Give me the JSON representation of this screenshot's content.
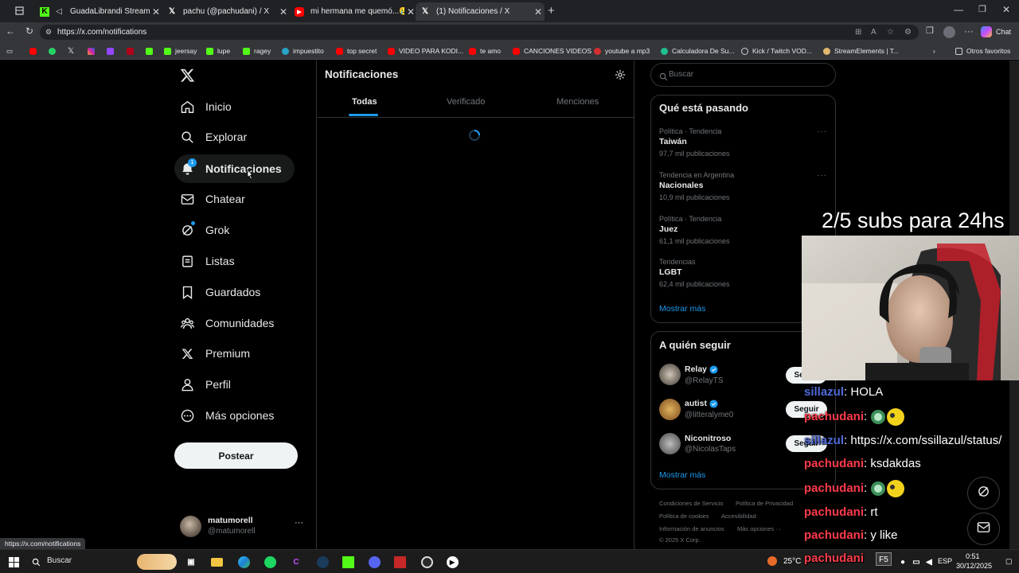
{
  "browser": {
    "tabs": [
      {
        "title": "GuadaLibrandi Stream - Watc",
        "icon": "kick-icon",
        "color": "#53fc18"
      },
      {
        "title": "pachu (@pachudani) / X",
        "icon": "x-icon",
        "color": "#ffffff"
      },
      {
        "title": "mi hermana me quemó...😢 - You",
        "icon": "youtube-icon",
        "color": "#ff0000"
      },
      {
        "title": "(1) Notificaciones / X",
        "icon": "x-icon",
        "color": "#ffffff"
      }
    ],
    "url": "https://x.com/notifications",
    "status_url": "https://x.com/notifications",
    "chat_label": "Chat",
    "bookmarks": [
      "jeersay",
      "lupe",
      "ragey",
      "impuestito",
      "top secret",
      "VIDEO PARA KODI...",
      "te amo",
      "CANCIONES VIDEOS",
      "youtube a mp3",
      "Calculadora De Su...",
      "Kick / Twitch VOD...",
      "StreamElements | T..."
    ],
    "other_bookmarks": "Otros favoritos"
  },
  "sidebar": {
    "items": [
      {
        "label": "Inicio",
        "icon": "home-icon"
      },
      {
        "label": "Explorar",
        "icon": "search-icon"
      },
      {
        "label": "Notificaciones",
        "icon": "bell-icon",
        "badge": "1"
      },
      {
        "label": "Chatear",
        "icon": "envelope-icon"
      },
      {
        "label": "Grok",
        "icon": "grok-icon"
      },
      {
        "label": "Listas",
        "icon": "list-icon"
      },
      {
        "label": "Guardados",
        "icon": "bookmark-icon"
      },
      {
        "label": "Comunidades",
        "icon": "communities-icon"
      },
      {
        "label": "Premium",
        "icon": "x-icon"
      },
      {
        "label": "Perfil",
        "icon": "person-icon"
      },
      {
        "label": "Más opciones",
        "icon": "more-circle-icon"
      }
    ],
    "post_label": "Postear",
    "account": {
      "name": "matumorell",
      "handle": "@matumorell"
    }
  },
  "main": {
    "title": "Notificaciones",
    "tabs": [
      "Todas",
      "Verificado",
      "Menciones"
    ]
  },
  "right": {
    "search_placeholder": "Buscar",
    "trends_title": "Qué está pasando",
    "trends": [
      {
        "category": "Política · Tendencia",
        "name": "Taiwán",
        "count": "97,7 mil publicaciones"
      },
      {
        "category": "Tendencia en Argentina",
        "name": "Nacionales",
        "count": "10,9 mil publicaciones"
      },
      {
        "category": "Política · Tendencia",
        "name": "Juez",
        "count": "61,1 mil publicaciones"
      },
      {
        "category": "Tendencias",
        "name": "LGBT",
        "count": "62,4 mil publicaciones"
      }
    ],
    "show_more": "Mostrar más",
    "follow_title": "A quién seguir",
    "follow": [
      {
        "name": "Relay",
        "handle": "@RelayTS",
        "verified": true
      },
      {
        "name": "autist",
        "handle": "@litteralyme0",
        "verified": true
      },
      {
        "name": "Niconitroso",
        "handle": "@NicolasTaps",
        "verified": false
      }
    ],
    "follow_button": "Seguir",
    "footer": [
      "Condiciones de Servicio",
      "Política de Privacidad",
      "Política de cookies",
      "Accesibilidad",
      "Información de anuncios",
      "Más opciones ···",
      "© 2025 X Corp."
    ]
  },
  "overlay": {
    "subs_text": "2/5 subs para 24hs",
    "chat": [
      {
        "user": "sillazul",
        "color": "#4f6bd8",
        "message": ": HOLA",
        "emote": false
      },
      {
        "user": "pachudani",
        "color": "#ff3b4a",
        "message": ": ",
        "emote": true
      },
      {
        "user": "sillazul",
        "color": "#4f6bd8",
        "message": ": https://x.com/ssillazul/status/",
        "emote": false
      },
      {
        "user": "pachudani",
        "color": "#ff3b4a",
        "message": ": ksdakdas",
        "emote": false
      },
      {
        "user": "pachudani",
        "color": "#ff3b4a",
        "message": ": ",
        "emote": true
      },
      {
        "user": "pachudani",
        "color": "#ff3b4a",
        "message": ": rt",
        "emote": false
      },
      {
        "user": "pachudani",
        "color": "#ff3b4a",
        "message": ": y like",
        "emote": false
      },
      {
        "user": "pachudani",
        "color": "#ff3b4a",
        "message": "",
        "emote": false
      }
    ]
  },
  "taskbar": {
    "search_placeholder": "Buscar",
    "weather": "25°C",
    "language": "ESP",
    "time": "0:51",
    "date": "30/12/2025"
  },
  "colors": {
    "accent": "#1d9bf0",
    "background": "#000000",
    "border": "#2f3336"
  }
}
